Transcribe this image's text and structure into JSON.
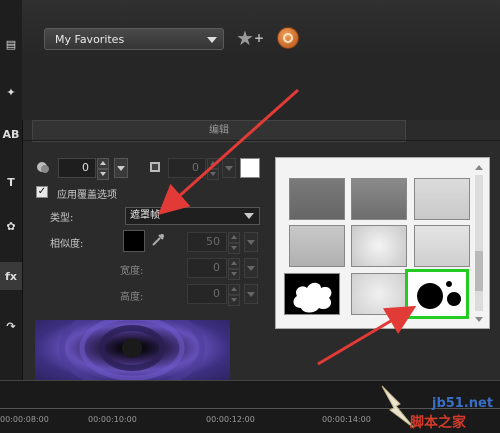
{
  "header": {
    "favorites_select": "My Favorites",
    "star_add_icon": "star-add-icon",
    "orange_icon": "gear-badge-icon"
  },
  "edit_tab": {
    "label": "编辑"
  },
  "controls": {
    "border_value": "0",
    "shadow_value": "0",
    "color_swatch": "#ffffff",
    "apply_overlay_label": "应用覆盖选项",
    "apply_overlay_checked": true,
    "type_label": "类型:",
    "type_value": "遮罩帧",
    "similarity_label": "相似度:",
    "similarity_value": "50",
    "width_label": "宽度:",
    "width_value": "0",
    "height_label": "高度:",
    "height_value": "0"
  },
  "gallery": {
    "selected_index": 8,
    "highlight_color": "#22cc22",
    "items": [
      "gray-frame-1",
      "gray-frame-2",
      "light-frame-1",
      "gray-frame-3",
      "texture-frame-1",
      "light-frame-2",
      "white-splash-mask",
      "texture-frame-2",
      "black-circles-mask"
    ]
  },
  "timeline": {
    "ticks": [
      "00:00:08:00",
      "00:00:10:00",
      "00:00:12:00",
      "00:00:14:00"
    ]
  },
  "watermark": {
    "domain": "jb51.net",
    "text": "脚本之家"
  },
  "colors": {
    "arrow": "#e23a36",
    "accent_green": "#22cc22"
  }
}
